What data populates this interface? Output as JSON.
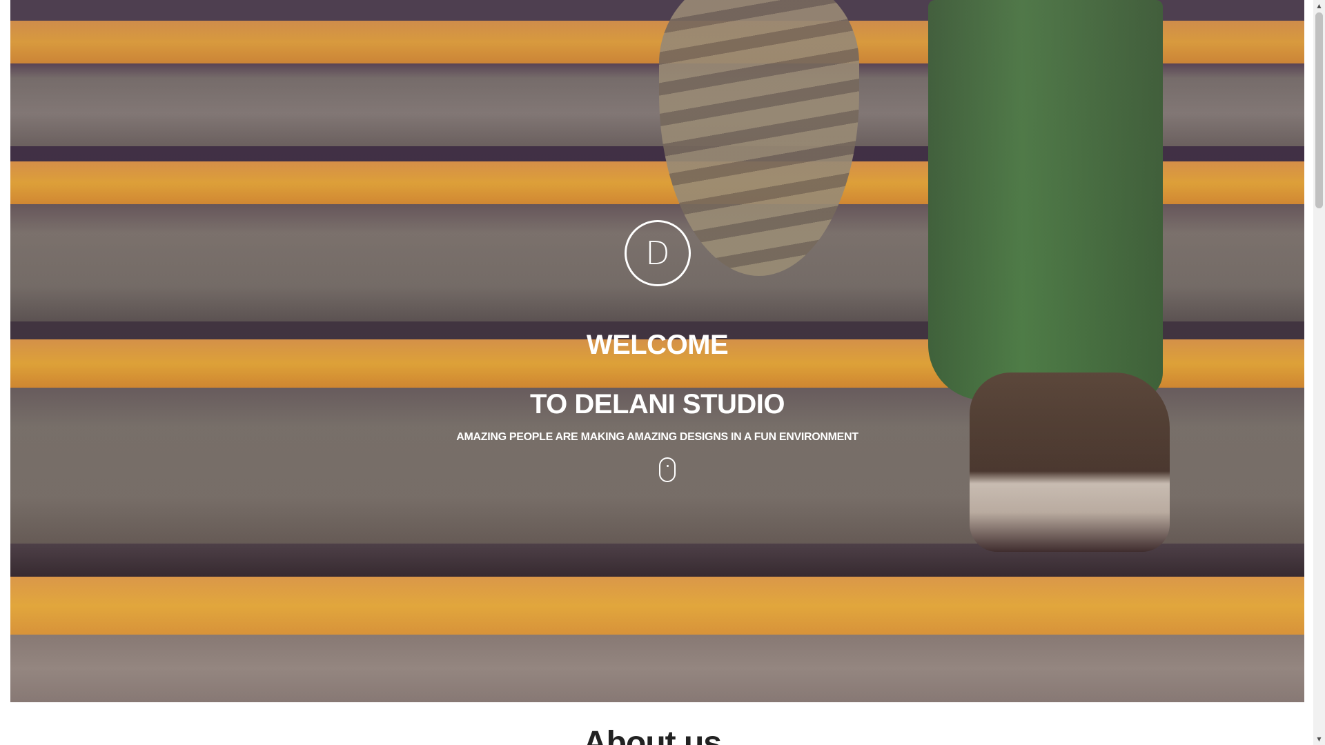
{
  "hero": {
    "logo_letter": "D",
    "title_line1": "WELCOME",
    "title_line2": "TO DELANI STUDIO",
    "subtitle": "AMAZING PEOPLE ARE MAKING AMAZING DESIGNS IN A FUN ENVIRONMENT",
    "scroll_icon": "mouse-scroll-icon"
  },
  "about": {
    "heading": "About us"
  },
  "colors": {
    "stripe_yellow": "#f2a623",
    "step_gray": "#6d6b62",
    "dark_edge": "#3e3534",
    "text": "#ffffff"
  },
  "scrollbar": {
    "up_icon": "▲",
    "down_icon": "▼"
  }
}
